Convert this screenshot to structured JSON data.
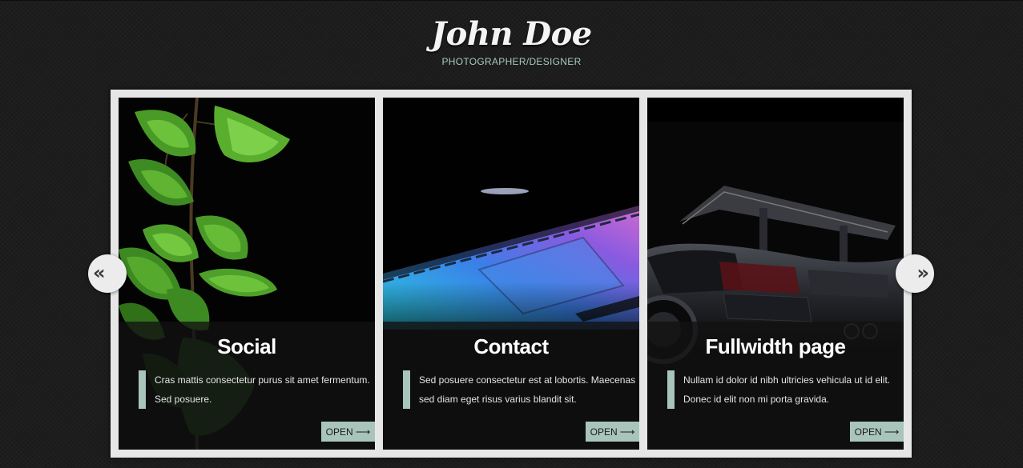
{
  "header": {
    "title": "John Doe",
    "subtitle": "PHOTOGRAPHER/DESIGNER"
  },
  "navigation": {
    "prev_label": "«",
    "next_label": "»",
    "prev_icon": "chevron-double-left-icon",
    "next_icon": "chevron-double-right-icon"
  },
  "cards": [
    {
      "title": "Social",
      "description": "Cras mattis consectetur purus sit amet fermentum. Sed posuere.",
      "button_label": "OPEN",
      "button_arrow": "⟶",
      "image_subject": "green ginkgo leaves on black"
    },
    {
      "title": "Contact",
      "description": "Sed posuere consectetur est at lobortis. Maecenas sed diam eget risus varius blandit sit.",
      "button_label": "OPEN",
      "button_arrow": "⟶",
      "image_subject": "laptop edge with colorful keyboard light"
    },
    {
      "title": "Fullwidth page",
      "description": "Nullam id dolor id nibh ultricies vehicula ut id elit. Donec id elit non mi porta gravida.",
      "button_label": "OPEN",
      "button_arrow": "⟶",
      "image_subject": "black sports car rear with spoiler"
    }
  ],
  "colors": {
    "background": "#1d1d1d",
    "frame": "#e6e6e6",
    "accent": "#a9c5bb",
    "caption_overlay": "#121212"
  }
}
